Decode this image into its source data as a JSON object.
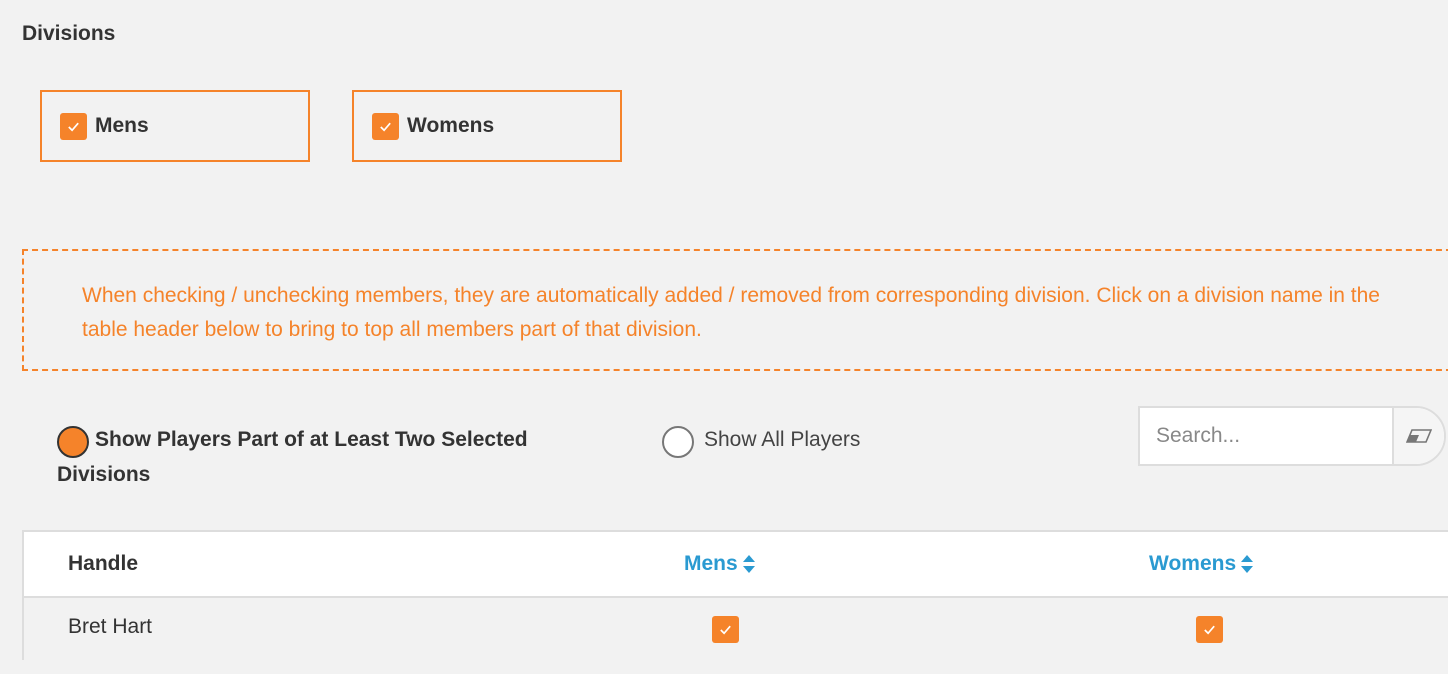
{
  "divisions": {
    "title": "Divisions",
    "items": [
      {
        "label": "Mens",
        "checked": true
      },
      {
        "label": "Womens",
        "checked": true
      }
    ]
  },
  "info_text": "When checking / unchecking members, they are automatically added / removed from corresponding division. Click on a division name in the table header below to bring to top all members part of that division.",
  "filter": {
    "option1_line1": "Show Players Part of at Least Two Selected",
    "option1_line2": "Divisions",
    "option1_selected": true,
    "option2": "Show All Players",
    "option2_selected": false
  },
  "search": {
    "placeholder": "Search...",
    "value": ""
  },
  "table": {
    "headers": {
      "handle": "Handle",
      "mens": "Mens",
      "womens": "Womens"
    },
    "rows": [
      {
        "handle": "Bret Hart",
        "mens": true,
        "womens": true
      }
    ]
  },
  "colors": {
    "accent": "#f5832a",
    "link": "#2a9ad1"
  }
}
